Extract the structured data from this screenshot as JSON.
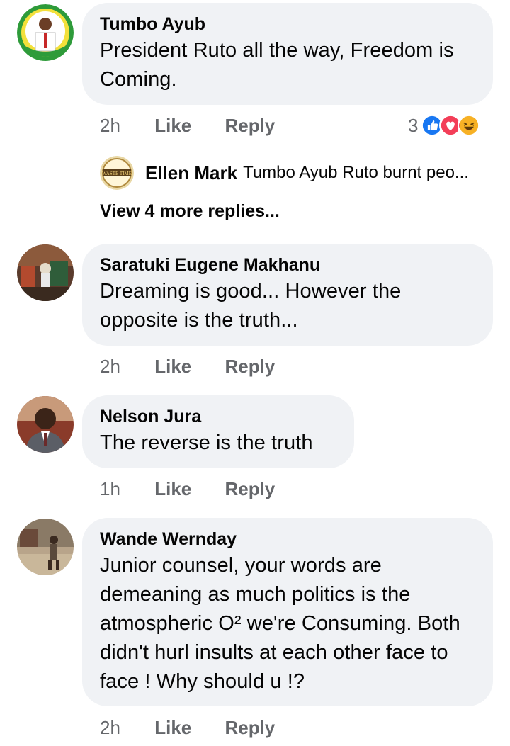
{
  "comments": [
    {
      "author": "Tumbo Ayub",
      "text": "President Ruto all the way, Freedom is Coming.",
      "time": "2h",
      "like_label": "Like",
      "reply_label": "Reply",
      "reaction_count": "3",
      "reactions": [
        "like-icon",
        "love-icon",
        "haha-icon"
      ],
      "reply_preview": {
        "author": "Ellen Mark",
        "text": "Tumbo Ayub Ruto burnt peo..."
      },
      "view_more_label": "View 4 more replies..."
    },
    {
      "author": "Saratuki Eugene Makhanu",
      "text": "Dreaming is good... However the opposite is the truth...",
      "time": "2h",
      "like_label": "Like",
      "reply_label": "Reply"
    },
    {
      "author": "Nelson Jura",
      "text": "The reverse is the truth",
      "time": "1h",
      "like_label": "Like",
      "reply_label": "Reply"
    },
    {
      "author": "Wande Wernday",
      "text": "Junior counsel, your words are demeaning as much politics is the atmospheric O² we're Consuming. Both didn't hurl insults at each other face to face ! Why should u !?",
      "time": "2h",
      "like_label": "Like",
      "reply_label": "Reply"
    }
  ],
  "colors": {
    "bubble": "#f0f2f5",
    "meta": "#65676b",
    "like_blue": "#1877f2",
    "love_red": "#f33e58",
    "haha_yellow": "#f7b125"
  }
}
